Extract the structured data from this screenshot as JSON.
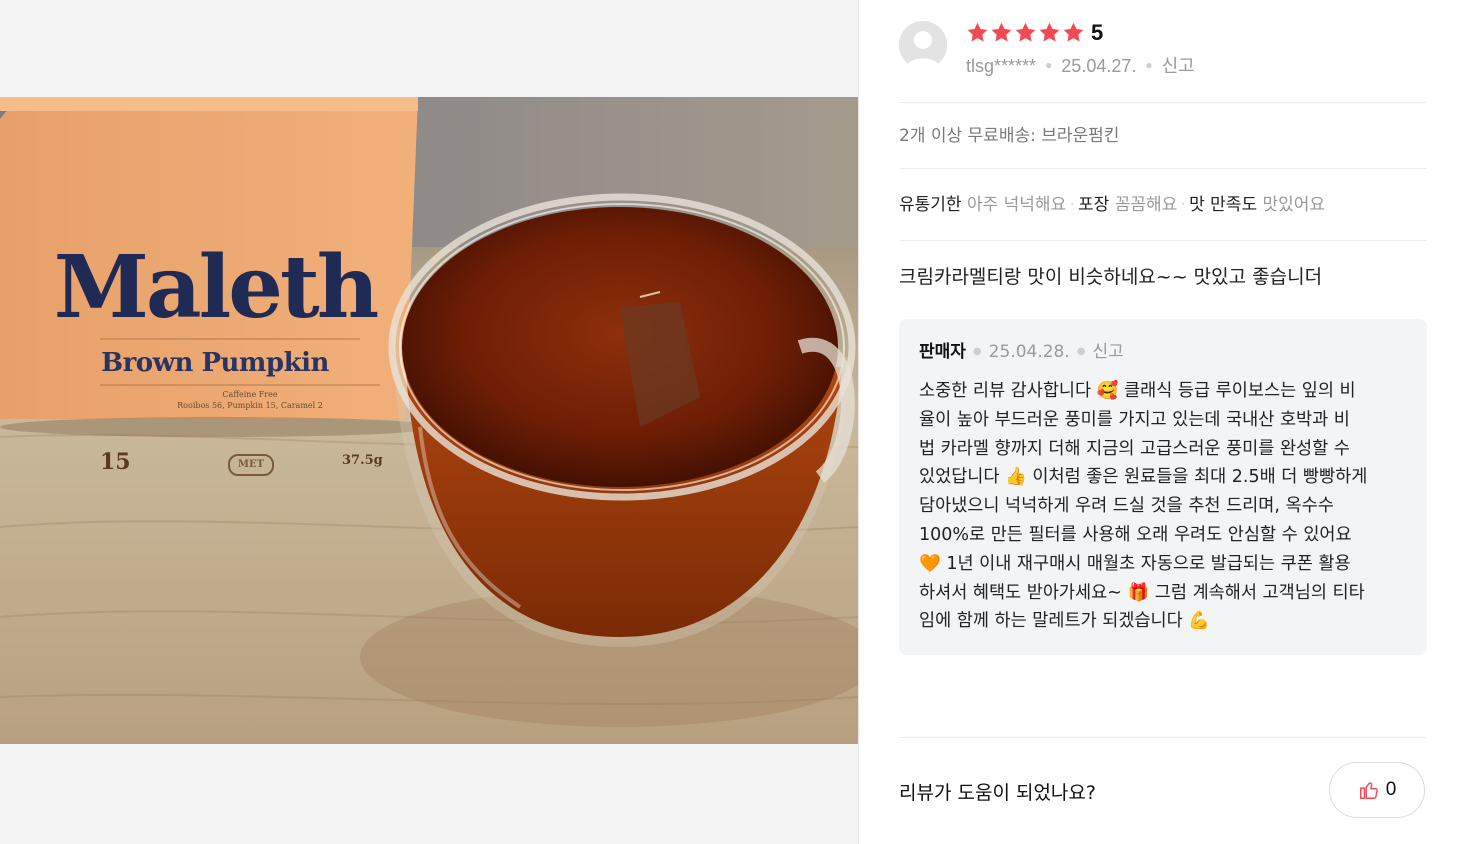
{
  "photo": {
    "box_brand": "Maleth",
    "box_subtitle": "Brown Pumpkin",
    "box_small_line1": "Caffeine Free",
    "box_small_line2": "Rooibos 56, Pumpkin 15, Caramel 2",
    "box_count": "15",
    "box_logo": "MET",
    "box_weight": "37.5g"
  },
  "review": {
    "rating": "5",
    "star_count": 5,
    "star_color": "#f24a55",
    "user": "tlsg******",
    "date": "25.04.27.",
    "report": "신고",
    "option": "2개 이상 무료배송: 브라운펌킨",
    "tags": [
      {
        "key": "유통기한",
        "value": "아주 넉넉해요"
      },
      {
        "key": "포장",
        "value": "꼼꼼해요"
      },
      {
        "key": "맛 만족도",
        "value": "맛있어요"
      }
    ],
    "text": "크림카라멜티랑 맛이 비슷하네요~~ 맛있고 좋습니더"
  },
  "reply": {
    "author": "판매자",
    "date": "25.04.28.",
    "report": "신고",
    "lines": [
      "소중한 리뷰 감사합니다 🥰 클래식 등급 루이보스는 잎의 비",
      "율이 높아 부드러운 풍미를 가지고 있는데 국내산 호박과 비",
      "법 카라멜 향까지 더해 지금의 고급스러운 풍미를 완성할 수",
      "있었답니다 👍 이처럼 좋은 원료들을 최대 2.5배 더 빵빵하게",
      "담아냈으니 넉넉하게 우려 드실 것을 추천 드리며, 옥수수",
      "100%로 만든 필터를 사용해 오래 우려도 안심할 수 있어요",
      "🧡 1년 이내 재구매시 매월초 자동으로 발급되는 쿠폰 활용",
      "하셔서 혜택도 받아가세요~ 🎁 그럼 계속해서 고객님의 티타",
      "임에 함께 하는 말레트가 되겠습니다 💪"
    ]
  },
  "helpful": {
    "label": "리뷰가 도움이 되었나요?",
    "count": "0",
    "icon_color": "#f24a55"
  }
}
